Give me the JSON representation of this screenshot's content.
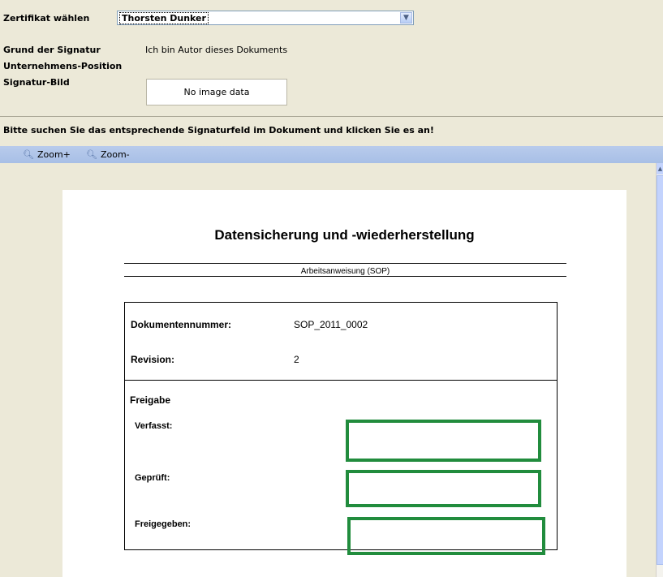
{
  "form": {
    "certificate_label": "Zertifikat wählen",
    "certificate_value": "Thorsten Dunker",
    "reason_label": "Grund der Signatur",
    "reason_value": "Ich bin Autor dieses Dokuments",
    "position_label": "Unternehmens-Position",
    "position_value": "",
    "image_label": "Signatur-Bild",
    "image_value": "No image data"
  },
  "instruction": "Bitte suchen Sie das entsprechende Signaturfeld im Dokument und klicken Sie es an!",
  "toolbar": {
    "zoom_in_label": "Zoom+",
    "zoom_out_label": "Zoom-"
  },
  "document": {
    "title": "Datensicherung und -wiederherstellung",
    "subtitle": "Arbeitsanweisung (SOP)",
    "doc_number_label": "Dokumentennummer:",
    "doc_number_value": "SOP_2011_0002",
    "revision_label": "Revision:",
    "revision_value": "2",
    "release_heading": "Freigabe",
    "signatures": [
      {
        "label": "Verfasst:"
      },
      {
        "label": "Geprüft:"
      },
      {
        "label": "Freigegeben:"
      }
    ]
  },
  "colors": {
    "signature_field": "#218c3d",
    "toolbar": "#b8cbec",
    "background": "#ece9d8"
  }
}
